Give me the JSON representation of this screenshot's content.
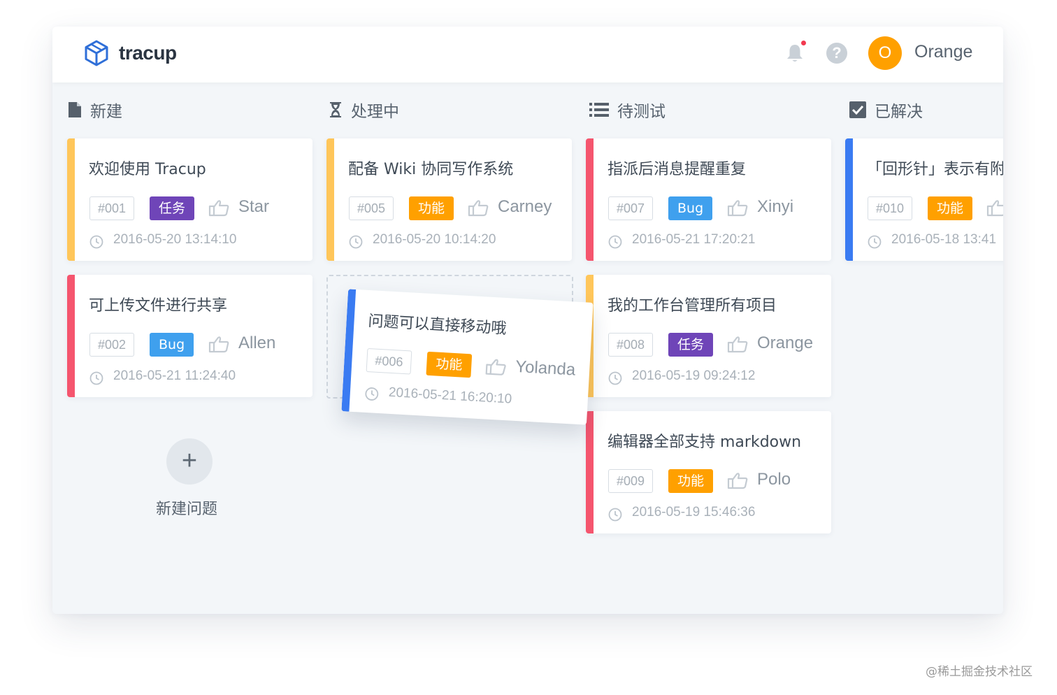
{
  "app": {
    "name": "tracup"
  },
  "header": {
    "user_initial": "O",
    "username": "Orange"
  },
  "columns": [
    {
      "title": "新建",
      "icon": "document-icon"
    },
    {
      "title": "处理中",
      "icon": "hourglass-icon"
    },
    {
      "title": "待测试",
      "icon": "list-icon"
    },
    {
      "title": "已解决",
      "icon": "checkbox-icon"
    }
  ],
  "cards": [
    {
      "title": "欢迎使用 Tracup",
      "id": "#001",
      "tag": "任务",
      "assignee": "Star",
      "time": "2016-05-20 13:14:10",
      "bar_color": "#ffc65a",
      "tag_color": "#6f45b8"
    },
    {
      "title": "可上传文件进行共享",
      "id": "#002",
      "tag": "Bug",
      "assignee": "Allen",
      "time": "2016-05-21 11:24:40",
      "bar_color": "#f5556e",
      "tag_color": "#3fa0ee"
    },
    {
      "title": "配备 Wiki 协同写作系统",
      "id": "#005",
      "tag": "功能",
      "assignee": "Carney",
      "time": "2016-05-20 10:14:20",
      "bar_color": "#ffc65a",
      "tag_color": "#ffa000"
    },
    {
      "title": "问题可以直接移动哦",
      "id": "#006",
      "tag": "功能",
      "assignee": "Yolanda",
      "time": "2016-05-21 16:20:10",
      "bar_color": "#3a7bf2",
      "tag_color": "#ffa000"
    },
    {
      "title": "指派后消息提醒重复",
      "id": "#007",
      "tag": "Bug",
      "assignee": "Xinyi",
      "time": "2016-05-21 17:20:21",
      "bar_color": "#f5556e",
      "tag_color": "#3fa0ee"
    },
    {
      "title": "我的工作台管理所有项目",
      "id": "#008",
      "tag": "任务",
      "assignee": "Orange",
      "time": "2016-05-19 09:24:12",
      "bar_color": "#ffc65a",
      "tag_color": "#6f45b8"
    },
    {
      "title": "编辑器全部支持 markdown",
      "id": "#009",
      "tag": "功能",
      "assignee": "Polo",
      "time": "2016-05-19 15:46:36",
      "bar_color": "#f5556e",
      "tag_color": "#ffa000"
    },
    {
      "title": "「回形针」表示有附件",
      "id": "#010",
      "tag": "功能",
      "assignee": "",
      "time": "2016-05-18 13:41",
      "bar_color": "#3a7bf2",
      "tag_color": "#ffa000"
    }
  ],
  "add_button": {
    "label": "新建问题",
    "symbol": "+"
  },
  "watermark": "@稀土掘金技术社区"
}
